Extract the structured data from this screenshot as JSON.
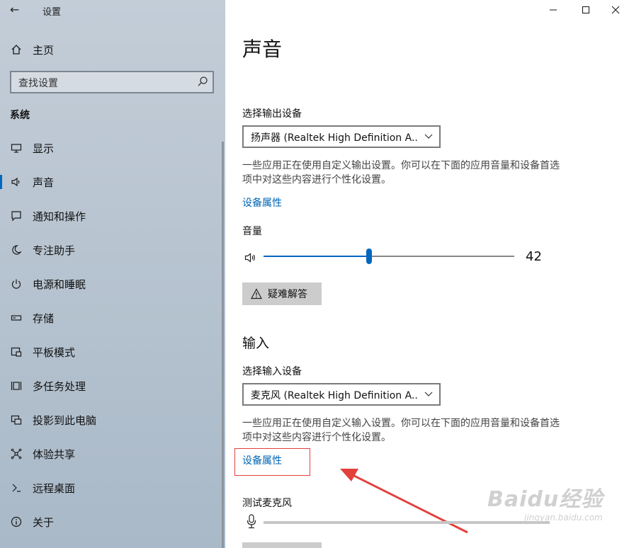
{
  "window": {
    "title": "设置",
    "controls": [
      "minimize",
      "maximize",
      "close"
    ]
  },
  "sidebar": {
    "home_label": "主页",
    "search_placeholder": "查找设置",
    "section_title": "系统",
    "items": [
      {
        "label": "显示",
        "icon": "display-icon"
      },
      {
        "label": "声音",
        "icon": "speaker-icon",
        "active": true
      },
      {
        "label": "通知和操作",
        "icon": "notification-icon"
      },
      {
        "label": "专注助手",
        "icon": "moon-icon"
      },
      {
        "label": "电源和睡眠",
        "icon": "power-icon"
      },
      {
        "label": "存储",
        "icon": "storage-icon"
      },
      {
        "label": "平板模式",
        "icon": "tablet-icon"
      },
      {
        "label": "多任务处理",
        "icon": "multitask-icon"
      },
      {
        "label": "投影到此电脑",
        "icon": "project-icon"
      },
      {
        "label": "体验共享",
        "icon": "share-icon"
      },
      {
        "label": "远程桌面",
        "icon": "remote-icon"
      },
      {
        "label": "关于",
        "icon": "info-icon"
      }
    ]
  },
  "main": {
    "title": "声音",
    "output": {
      "device_label": "选择输出设备",
      "device_value": "扬声器 (Realtek High Definition A...",
      "description": "一些应用正在使用自定义输出设置。你可以在下面的应用音量和设备首选项中对这些内容进行个性化设置。",
      "properties_link": "设备属性",
      "volume_label": "音量",
      "volume_value": "42",
      "volume_fraction": 0.42,
      "troubleshoot_label": "疑难解答"
    },
    "input": {
      "heading": "输入",
      "device_label": "选择输入设备",
      "device_value": "麦克风 (Realtek High Definition A...",
      "description": "一些应用正在使用自定义输入设置。你可以在下面的应用音量和设备首选项中对这些内容进行个性化设置。",
      "properties_link": "设备属性",
      "test_label": "测试麦克风",
      "level_fraction": 0.0
    }
  },
  "watermark": {
    "brand": "Baidu经验",
    "url": "jingyan.baidu.com"
  },
  "colors": {
    "accent": "#0067c0",
    "link": "#0066b4",
    "annotation": "#e2403b"
  }
}
